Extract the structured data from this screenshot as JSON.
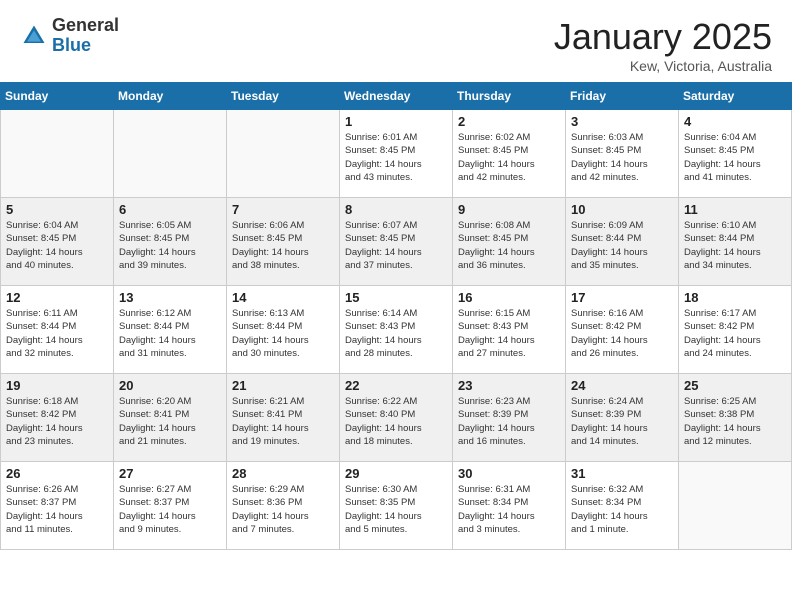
{
  "header": {
    "logo_general": "General",
    "logo_blue": "Blue",
    "month_title": "January 2025",
    "location": "Kew, Victoria, Australia"
  },
  "weekdays": [
    "Sunday",
    "Monday",
    "Tuesday",
    "Wednesday",
    "Thursday",
    "Friday",
    "Saturday"
  ],
  "weeks": [
    [
      {
        "day": "",
        "info": ""
      },
      {
        "day": "",
        "info": ""
      },
      {
        "day": "",
        "info": ""
      },
      {
        "day": "1",
        "info": "Sunrise: 6:01 AM\nSunset: 8:45 PM\nDaylight: 14 hours\nand 43 minutes."
      },
      {
        "day": "2",
        "info": "Sunrise: 6:02 AM\nSunset: 8:45 PM\nDaylight: 14 hours\nand 42 minutes."
      },
      {
        "day": "3",
        "info": "Sunrise: 6:03 AM\nSunset: 8:45 PM\nDaylight: 14 hours\nand 42 minutes."
      },
      {
        "day": "4",
        "info": "Sunrise: 6:04 AM\nSunset: 8:45 PM\nDaylight: 14 hours\nand 41 minutes."
      }
    ],
    [
      {
        "day": "5",
        "info": "Sunrise: 6:04 AM\nSunset: 8:45 PM\nDaylight: 14 hours\nand 40 minutes."
      },
      {
        "day": "6",
        "info": "Sunrise: 6:05 AM\nSunset: 8:45 PM\nDaylight: 14 hours\nand 39 minutes."
      },
      {
        "day": "7",
        "info": "Sunrise: 6:06 AM\nSunset: 8:45 PM\nDaylight: 14 hours\nand 38 minutes."
      },
      {
        "day": "8",
        "info": "Sunrise: 6:07 AM\nSunset: 8:45 PM\nDaylight: 14 hours\nand 37 minutes."
      },
      {
        "day": "9",
        "info": "Sunrise: 6:08 AM\nSunset: 8:45 PM\nDaylight: 14 hours\nand 36 minutes."
      },
      {
        "day": "10",
        "info": "Sunrise: 6:09 AM\nSunset: 8:44 PM\nDaylight: 14 hours\nand 35 minutes."
      },
      {
        "day": "11",
        "info": "Sunrise: 6:10 AM\nSunset: 8:44 PM\nDaylight: 14 hours\nand 34 minutes."
      }
    ],
    [
      {
        "day": "12",
        "info": "Sunrise: 6:11 AM\nSunset: 8:44 PM\nDaylight: 14 hours\nand 32 minutes."
      },
      {
        "day": "13",
        "info": "Sunrise: 6:12 AM\nSunset: 8:44 PM\nDaylight: 14 hours\nand 31 minutes."
      },
      {
        "day": "14",
        "info": "Sunrise: 6:13 AM\nSunset: 8:44 PM\nDaylight: 14 hours\nand 30 minutes."
      },
      {
        "day": "15",
        "info": "Sunrise: 6:14 AM\nSunset: 8:43 PM\nDaylight: 14 hours\nand 28 minutes."
      },
      {
        "day": "16",
        "info": "Sunrise: 6:15 AM\nSunset: 8:43 PM\nDaylight: 14 hours\nand 27 minutes."
      },
      {
        "day": "17",
        "info": "Sunrise: 6:16 AM\nSunset: 8:42 PM\nDaylight: 14 hours\nand 26 minutes."
      },
      {
        "day": "18",
        "info": "Sunrise: 6:17 AM\nSunset: 8:42 PM\nDaylight: 14 hours\nand 24 minutes."
      }
    ],
    [
      {
        "day": "19",
        "info": "Sunrise: 6:18 AM\nSunset: 8:42 PM\nDaylight: 14 hours\nand 23 minutes."
      },
      {
        "day": "20",
        "info": "Sunrise: 6:20 AM\nSunset: 8:41 PM\nDaylight: 14 hours\nand 21 minutes."
      },
      {
        "day": "21",
        "info": "Sunrise: 6:21 AM\nSunset: 8:41 PM\nDaylight: 14 hours\nand 19 minutes."
      },
      {
        "day": "22",
        "info": "Sunrise: 6:22 AM\nSunset: 8:40 PM\nDaylight: 14 hours\nand 18 minutes."
      },
      {
        "day": "23",
        "info": "Sunrise: 6:23 AM\nSunset: 8:39 PM\nDaylight: 14 hours\nand 16 minutes."
      },
      {
        "day": "24",
        "info": "Sunrise: 6:24 AM\nSunset: 8:39 PM\nDaylight: 14 hours\nand 14 minutes."
      },
      {
        "day": "25",
        "info": "Sunrise: 6:25 AM\nSunset: 8:38 PM\nDaylight: 14 hours\nand 12 minutes."
      }
    ],
    [
      {
        "day": "26",
        "info": "Sunrise: 6:26 AM\nSunset: 8:37 PM\nDaylight: 14 hours\nand 11 minutes."
      },
      {
        "day": "27",
        "info": "Sunrise: 6:27 AM\nSunset: 8:37 PM\nDaylight: 14 hours\nand 9 minutes."
      },
      {
        "day": "28",
        "info": "Sunrise: 6:29 AM\nSunset: 8:36 PM\nDaylight: 14 hours\nand 7 minutes."
      },
      {
        "day": "29",
        "info": "Sunrise: 6:30 AM\nSunset: 8:35 PM\nDaylight: 14 hours\nand 5 minutes."
      },
      {
        "day": "30",
        "info": "Sunrise: 6:31 AM\nSunset: 8:34 PM\nDaylight: 14 hours\nand 3 minutes."
      },
      {
        "day": "31",
        "info": "Sunrise: 6:32 AM\nSunset: 8:34 PM\nDaylight: 14 hours\nand 1 minute."
      },
      {
        "day": "",
        "info": ""
      }
    ]
  ]
}
